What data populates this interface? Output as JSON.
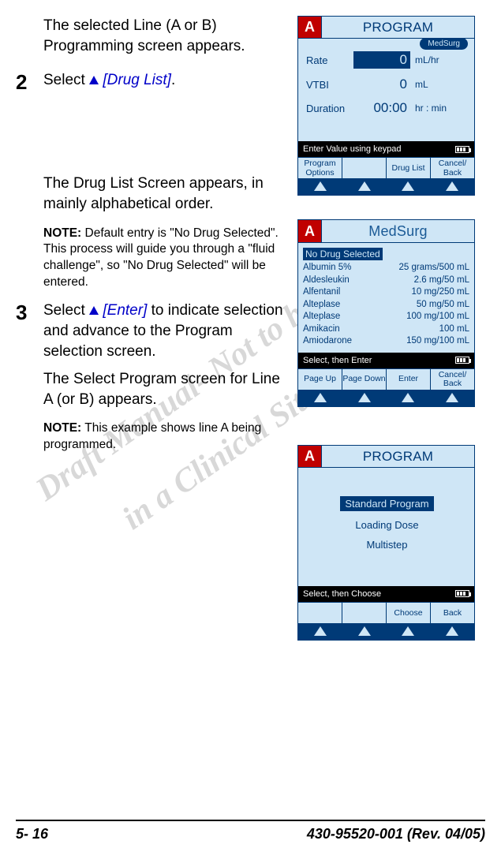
{
  "watermark": {
    "line1": "Draft Manual- Not to be used",
    "line2": "in a Clinical Situation."
  },
  "text": {
    "p1": "The selected Line (A or B) Programming screen appears.",
    "step2_num": "2",
    "step2_pre": "Select ",
    "step2_link": "[Drug List]",
    "step2_post": ".",
    "p2": "The Drug List Screen appears, in mainly alphabetical order.",
    "note1_label": "NOTE:",
    "note1_body": " Default entry is \"No Drug Selected\". This process will guide you through a \"fluid challenge\", so \"No Drug Selected\" will be entered.",
    "step3_num": "3",
    "step3_pre": "Select ",
    "step3_link": "[Enter]",
    "step3_post": " to indicate selection and advance to the Program selection screen.",
    "p3": "The Select Program screen for Line A (or B) appears.",
    "note2_label": "NOTE:",
    "note2_body": " This example shows line A being programmed."
  },
  "screen1": {
    "line": "A",
    "title": "PROGRAM",
    "tag": "MedSurg",
    "rows": [
      {
        "label": "Rate",
        "value": "0",
        "unit": "mL/hr",
        "inverted": true
      },
      {
        "label": "VTBI",
        "value": "0",
        "unit": "mL",
        "inverted": false
      },
      {
        "label": "Duration",
        "value": "00:00",
        "unit": "hr : min",
        "inverted": false
      }
    ],
    "prompt": "Enter Value using keypad",
    "softkeys": [
      "Program Options",
      "",
      "Drug List",
      "Cancel/ Back"
    ]
  },
  "screen2": {
    "line": "A",
    "title": "MedSurg",
    "selected": "No Drug Selected",
    "drugs": [
      {
        "name": "Albumin 5%",
        "dose": "25 grams/500 mL"
      },
      {
        "name": "Aldesleukin",
        "dose": "2.6 mg/50 mL"
      },
      {
        "name": "Alfentanil",
        "dose": "10 mg/250 mL"
      },
      {
        "name": "Alteplase",
        "dose": "50 mg/50 mL"
      },
      {
        "name": "Alteplase",
        "dose": "100 mg/100 mL"
      },
      {
        "name": "Amikacin",
        "dose": "100 mL"
      },
      {
        "name": "Amiodarone",
        "dose": "150 mg/100 mL"
      }
    ],
    "prompt": "Select, then Enter",
    "softkeys": [
      "Page Up",
      "Page Down",
      "Enter",
      "Cancel/ Back"
    ]
  },
  "screen3": {
    "line": "A",
    "title": "PROGRAM",
    "items": [
      {
        "label": "Standard Program",
        "selected": true
      },
      {
        "label": "Loading Dose",
        "selected": false
      },
      {
        "label": "Multistep",
        "selected": false
      }
    ],
    "prompt": "Select, then Choose",
    "softkeys": [
      "",
      "",
      "Choose",
      "Back"
    ]
  },
  "footer": {
    "left": "5- 16",
    "right": "430-95520-001 (Rev. 04/05)"
  }
}
